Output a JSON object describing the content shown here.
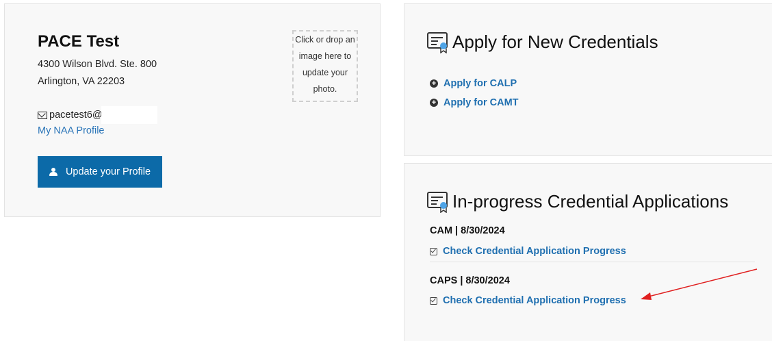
{
  "profile": {
    "name": "PACE Test",
    "address_line1": "4300 Wilson Blvd. Ste. 800",
    "address_line2": "Arlington, VA 22203",
    "email": "pacetest6@",
    "email_icon": "envelope-icon",
    "naa_profile_link": "My NAA Profile",
    "update_button": "Update your Profile",
    "update_icon": "user-icon",
    "photo_drop_text": "Click or drop an image here to update your photo."
  },
  "apply": {
    "title": "Apply for New Credentials",
    "title_icon": "certificate-icon",
    "items": [
      {
        "label": "Apply for CALP",
        "icon": "plus-circle-icon"
      },
      {
        "label": "Apply for CAMT",
        "icon": "plus-circle-icon"
      }
    ]
  },
  "in_progress": {
    "title": "In-progress Credential Applications",
    "title_icon": "certificate-icon",
    "applications": [
      {
        "label": "CAM | 8/30/2024",
        "link": "Check Credential Application Progress",
        "icon": "check-square-icon"
      },
      {
        "label": "CAPS | 8/30/2024",
        "link": "Check Credential Application Progress",
        "icon": "check-square-icon"
      }
    ]
  },
  "colors": {
    "link": "#1f6fb0",
    "button": "#0c6aa8",
    "annotation_arrow": "#e02020",
    "card_bg": "#f8f8f8"
  }
}
